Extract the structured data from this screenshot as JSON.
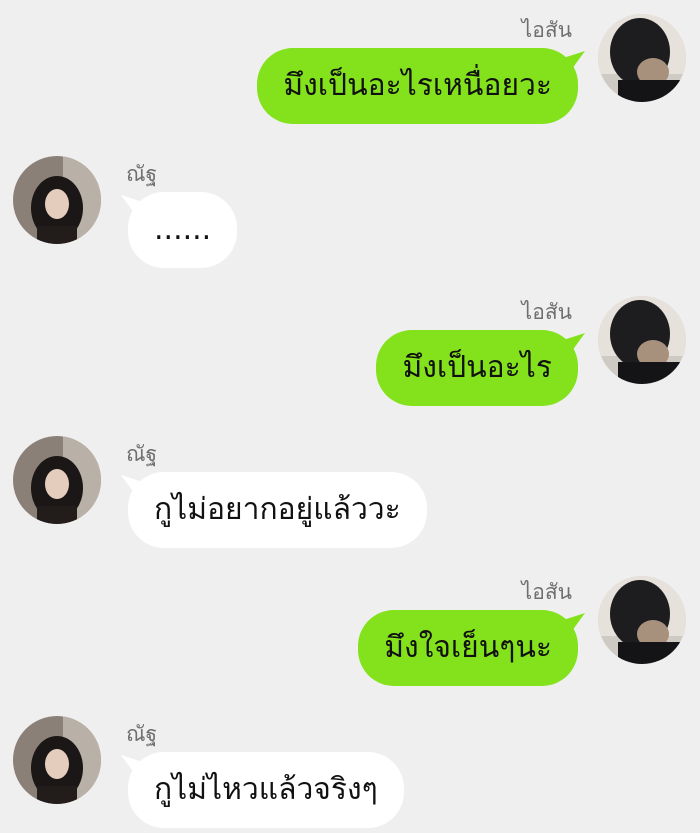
{
  "conversation": {
    "messages": [
      {
        "direction": "outgoing",
        "sender": "ไอสัน",
        "text": "มึงเป็นอะไรเหนื่อยวะ"
      },
      {
        "direction": "incoming",
        "sender": "ณัฐ",
        "text": "......"
      },
      {
        "direction": "outgoing",
        "sender": "ไอสัน",
        "text": "มึงเป็นอะไร"
      },
      {
        "direction": "incoming",
        "sender": "ณัฐ",
        "text": "กูไม่อยากอยู่แล้ววะ"
      },
      {
        "direction": "outgoing",
        "sender": "ไอสัน",
        "text": "มึงใจเย็นๆนะ"
      },
      {
        "direction": "incoming",
        "sender": "ณัฐ",
        "text": "กูไม่ไหวแล้วจริงๆ"
      }
    ]
  },
  "colors": {
    "background": "#efefef",
    "outgoing_bubble": "#84e21c",
    "incoming_bubble": "#ffffff",
    "sender_name": "#6f6f6f"
  }
}
